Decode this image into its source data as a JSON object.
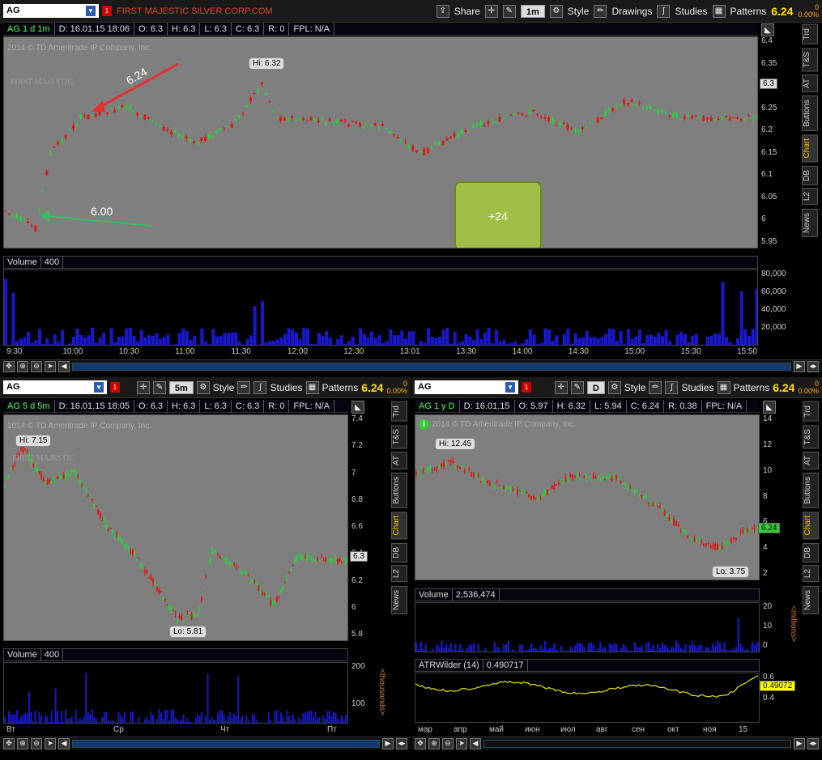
{
  "top": {
    "symbol": "AG",
    "company": "FIRST MAJESTIC SILVER CORP.COM",
    "share": "Share",
    "timeframe": "1m",
    "style": "Style",
    "drawings": "Drawings",
    "studies": "Studies",
    "patterns": "Patterns",
    "price": "6.24",
    "change": "0",
    "change_pct": "0.00%",
    "info": {
      "label": "AG 1 d 1m",
      "d": "D: 16.01.15 18:06",
      "o": "O: 6.3",
      "h": "H: 6.3",
      "l": "L: 6.3",
      "c": "C: 6.3",
      "r": "R: 0",
      "fpl": "FPL: N/A"
    },
    "copyright": "2014 © TD Ameritrade IP Company, Inc.",
    "watermark": "FIRST MAJESTIC",
    "hi": "Hi: 6.32",
    "ann_high": "6.24",
    "ann_low": "6.00",
    "green_box": "+24",
    "price_tag": "6.3",
    "yticks": [
      "6.4",
      "6.35",
      "6.3",
      "6.25",
      "6.2",
      "6.15",
      "6.1",
      "6.05",
      "6",
      "5.95"
    ],
    "volume_label": "Volume",
    "volume_value": "400",
    "vol_ticks": [
      "80,000",
      "60,000",
      "40,000",
      "20,000"
    ],
    "xticks": [
      "9:30",
      "10:00",
      "10:30",
      "11:00",
      "11:30",
      "12:00",
      "12:30",
      "13:01",
      "13:30",
      "14:00",
      "14:30",
      "15:00",
      "15:30",
      "15:50"
    ],
    "side_tabs": [
      "Trd",
      "T&S",
      "AT",
      "Buttons",
      "Chart",
      "DB",
      "L2",
      "News"
    ]
  },
  "left": {
    "symbol": "AG",
    "timeframe": "5m",
    "style": "Style",
    "studies": "Studies",
    "patterns": "Patterns",
    "price": "6.24",
    "change": "0",
    "change_pct": "0.00%",
    "info": {
      "label": "AG 5 d 5m",
      "d": "D: 16.01.15 18:05",
      "o": "O: 6.3",
      "h": "H: 6.3",
      "l": "L: 6.3",
      "c": "C: 6.3",
      "r": "R: 0",
      "fpl": "FPL: N/A"
    },
    "copyright": "2014 © TD Ameritrade IP Company, Inc.",
    "watermark": "FIRST MAJESTIC",
    "hi": "Hi: 7.15",
    "lo": "Lo: 5.81",
    "price_tag": "6.3",
    "yticks": [
      "7.4",
      "7.2",
      "7",
      "6.8",
      "6.6",
      "6.4",
      "6.2",
      "6",
      "5.8"
    ],
    "volume_label": "Volume",
    "volume_value": "400",
    "vol_ticks": [
      "200",
      "100"
    ],
    "vol_unit": "<thousands>",
    "xticks": [
      "Вт",
      "Ср",
      "Чт",
      "Пт"
    ],
    "side_tabs": [
      "Trd",
      "T&S",
      "AT",
      "Buttons",
      "Chart",
      "DB",
      "L2",
      "News"
    ]
  },
  "right": {
    "symbol": "AG",
    "timeframe": "D",
    "style": "Style",
    "studies": "Studies",
    "patterns": "Patterns",
    "price": "6.24",
    "change": "0",
    "change_pct": "0.00%",
    "info": {
      "label": "AG 1 y D",
      "d": "D: 16.01.15",
      "o": "O: 5.97",
      "h": "H: 6.32",
      "l": "L: 5.94",
      "c": "C: 6.24",
      "r": "R: 0.38",
      "fpl": "FPL: N/A"
    },
    "copyright": "2014 © TD Ameritrade IP Company, Inc.",
    "hi": "Hi: 12.45",
    "lo": "Lo: 3.75",
    "price_tag": "6.24",
    "yticks": [
      "14",
      "12",
      "10",
      "8",
      "6",
      "4",
      "2"
    ],
    "volume_label": "Volume",
    "volume_value": "2,536,474",
    "vol_ticks": [
      "20",
      "10",
      "0"
    ],
    "vol_unit": "<millions>",
    "atr_label": "ATRWilder (14)",
    "atr_value": "0.490717",
    "atr_tag": "0.49072",
    "atr_ticks": [
      "0.6",
      "0.4"
    ],
    "xticks": [
      "мар",
      "апр",
      "май",
      "июн",
      "июл",
      "авг",
      "сен",
      "окт",
      "ноя",
      "15"
    ],
    "side_tabs": [
      "Trd",
      "T&S",
      "AT",
      "Buttons",
      "Chart",
      "DB",
      "L2",
      "News"
    ]
  }
}
